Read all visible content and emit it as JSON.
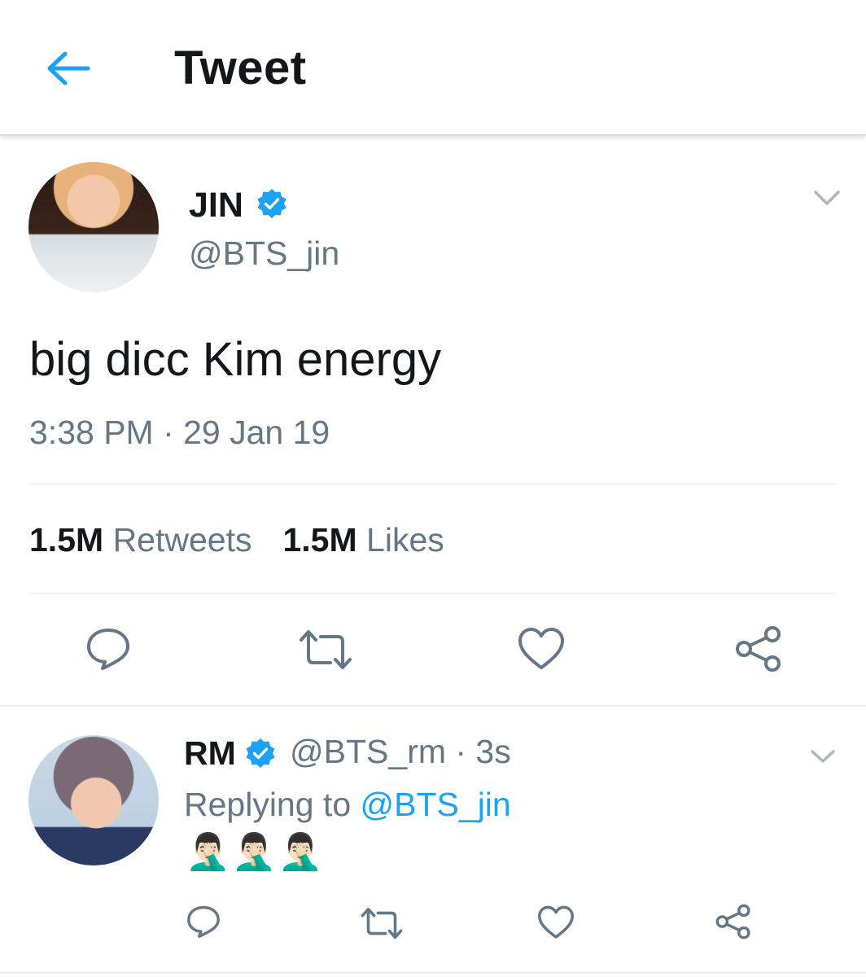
{
  "header": {
    "title": "Tweet",
    "back_icon": "arrow-left-icon"
  },
  "tweet": {
    "display_name": "JIN",
    "handle": "@BTS_jin",
    "verified": true,
    "text": "big dicc Kim energy",
    "timestamp": "3:38 PM · 29 Jan 19",
    "retweets_count": "1.5M",
    "retweets_label": "Retweets",
    "likes_count": "1.5M",
    "likes_label": "Likes",
    "actions": [
      "reply-icon",
      "retweet-icon",
      "like-icon",
      "share-icon"
    ]
  },
  "reply": {
    "display_name": "RM",
    "handle": "@BTS_rm",
    "time": "3s",
    "meta_separator": " · ",
    "replying_prefix": "Replying to",
    "replying_to": "@BTS_jin",
    "emojis": "🤦🏻‍♂️🤦🏻‍♂️🤦🏻‍♂️",
    "verified": true,
    "actions": [
      "reply-icon",
      "retweet-icon",
      "like-icon",
      "share-icon"
    ]
  },
  "colors": {
    "accent": "#1da1f2",
    "text": "#14171a",
    "secondary": "#657786",
    "icon": "#657786",
    "divider": "#e1e8ed"
  }
}
